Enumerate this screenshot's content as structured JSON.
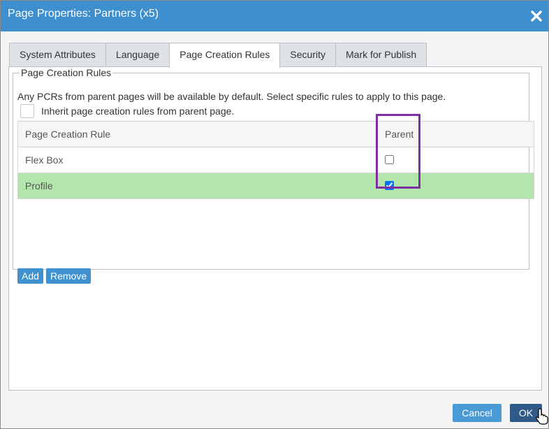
{
  "window": {
    "title": "Page Properties: Partners (x5)",
    "close_icon": "close-icon"
  },
  "tabs": [
    {
      "label": "System Attributes",
      "active": false
    },
    {
      "label": "Language",
      "active": false
    },
    {
      "label": "Page Creation Rules",
      "active": true
    },
    {
      "label": "Security",
      "active": false
    },
    {
      "label": "Mark for Publish",
      "active": false
    }
  ],
  "pcr": {
    "legend": "Page Creation Rules",
    "description": "Any PCRs from parent pages will be available by default. Select specific rules to apply to this page.",
    "inherit_label": "Inherit page creation rules from parent page.",
    "inherit_checked": false,
    "columns": {
      "rule": "Page Creation Rule",
      "parent": "Parent"
    },
    "rows": [
      {
        "rule": "Flex Box",
        "parent_checked": false,
        "selected": false
      },
      {
        "rule": "Profile",
        "parent_checked": true,
        "selected": true
      }
    ],
    "add_label": "Add",
    "remove_label": "Remove"
  },
  "footer": {
    "cancel_label": "Cancel",
    "ok_label": "OK"
  },
  "colors": {
    "titlebar": "#3e8fcd",
    "selected_row": "#b3e6ad",
    "highlight_box": "#7d2fa3",
    "button": "#3f92cf",
    "ok_button": "#2f5a8a"
  }
}
